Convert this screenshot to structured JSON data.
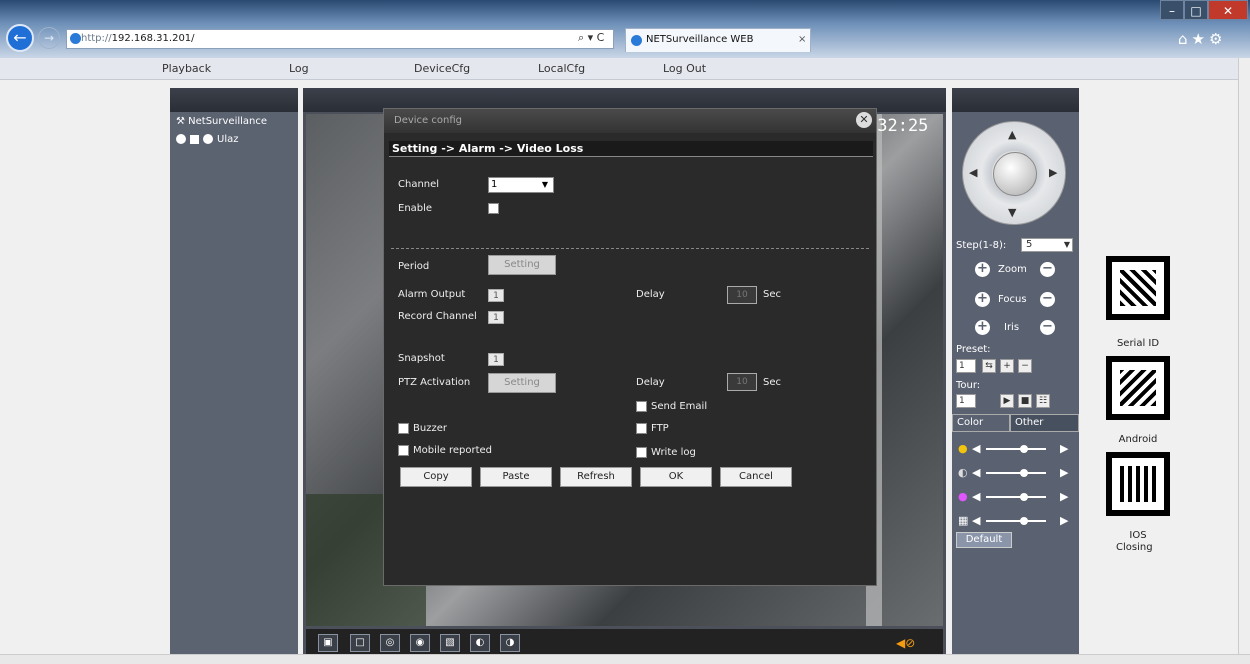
{
  "browser": {
    "url_prefix": "http://",
    "url_host": "192.168.31.201/",
    "search_ctrl": "⌕ ▾ C",
    "tab_title": "NETSurveillance WEB",
    "tab_close": "×",
    "win_min": "–",
    "win_max": "□",
    "win_close": "✕",
    "toolbar_icons": "⌂★⚙"
  },
  "nav": {
    "playback": "Playback",
    "log": "Log",
    "devicecfg": "DeviceCfg",
    "localcfg": "LocalCfg",
    "logout": "Log Out"
  },
  "device_tree": {
    "root": "NetSurveillance",
    "device": "Ulaz"
  },
  "video": {
    "time_osd": ":32:25"
  },
  "dialog": {
    "title": "Device config",
    "breadcrumb": "Setting -> Alarm -> Video Loss",
    "channel_label": "Channel",
    "channel_value": "1",
    "enable_label": "Enable",
    "period_label": "Period",
    "period_button": "Setting",
    "alarm_output_label": "Alarm Output",
    "alarm_output_value": "1",
    "record_channel_label": "Record Channel",
    "record_channel_value": "1",
    "delay_label_1": "Delay",
    "delay_value_1": "10",
    "sec_label_1": "Sec",
    "snapshot_label": "Snapshot",
    "snapshot_value": "1",
    "ptz_label": "PTZ Activation",
    "ptz_button": "Setting",
    "delay_label_2": "Delay",
    "delay_value_2": "10",
    "sec_label_2": "Sec",
    "send_email": "Send Email",
    "buzzer": "Buzzer",
    "ftp": "FTP",
    "mobile_reported": "Mobile reported",
    "write_log": "Write log",
    "buttons": {
      "copy": "Copy",
      "paste": "Paste",
      "refresh": "Refresh",
      "ok": "OK",
      "cancel": "Cancel"
    }
  },
  "ptz": {
    "step_label": "Step(1-8):",
    "step_value": "5",
    "zoom": "Zoom",
    "focus": "Focus",
    "iris": "Iris",
    "preset_label": "Preset:",
    "preset_value": "1",
    "tour_label": "Tour:",
    "tour_value": "1",
    "tab_color": "Color",
    "tab_other": "Other",
    "default_button": "Default"
  },
  "qr": {
    "serial_id": "Serial ID",
    "android": "Android",
    "ios": "IOS",
    "closing": "Closing"
  },
  "colors": {
    "panel": "#5a6171",
    "dialog_bg": "#2a2a2a",
    "accent": "#1f6fd6"
  }
}
